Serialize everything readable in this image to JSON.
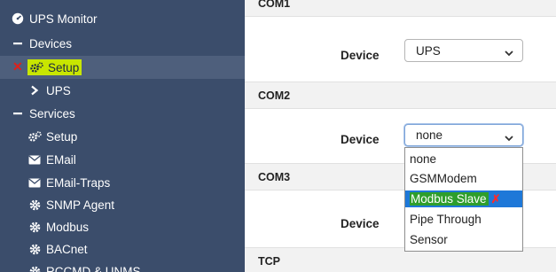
{
  "sidebar": {
    "title": "UPS Monitor",
    "devices_label": "Devices",
    "devices_setup_label": "Setup",
    "ups_label": "UPS",
    "services_label": "Services",
    "services_items": [
      "Setup",
      "EMail",
      "EMail-Traps",
      "SNMP Agent",
      "Modbus",
      "BACnet",
      "RCCMD & UNMS"
    ],
    "annotation_mark": "✕"
  },
  "main": {
    "com1_label": "COM1",
    "com2_label": "COM2",
    "com3_label": "COM3",
    "tcp_label": "TCP",
    "device_label": "Device",
    "com1_value": "UPS",
    "com2_value": "none",
    "dropdown_options": [
      "none",
      "GSMModem",
      "Modbus Slave",
      "Pipe Through",
      "Sensor"
    ],
    "selected_option_index": 2,
    "selected_mark": "✗"
  },
  "colors": {
    "sidebar_bg": "#3b4d6b",
    "highlight_yellow": "#c8e600",
    "highlight_green": "#2e9e2c",
    "selected_blue": "#1e78d8",
    "annotation_red": "#e0201a"
  }
}
